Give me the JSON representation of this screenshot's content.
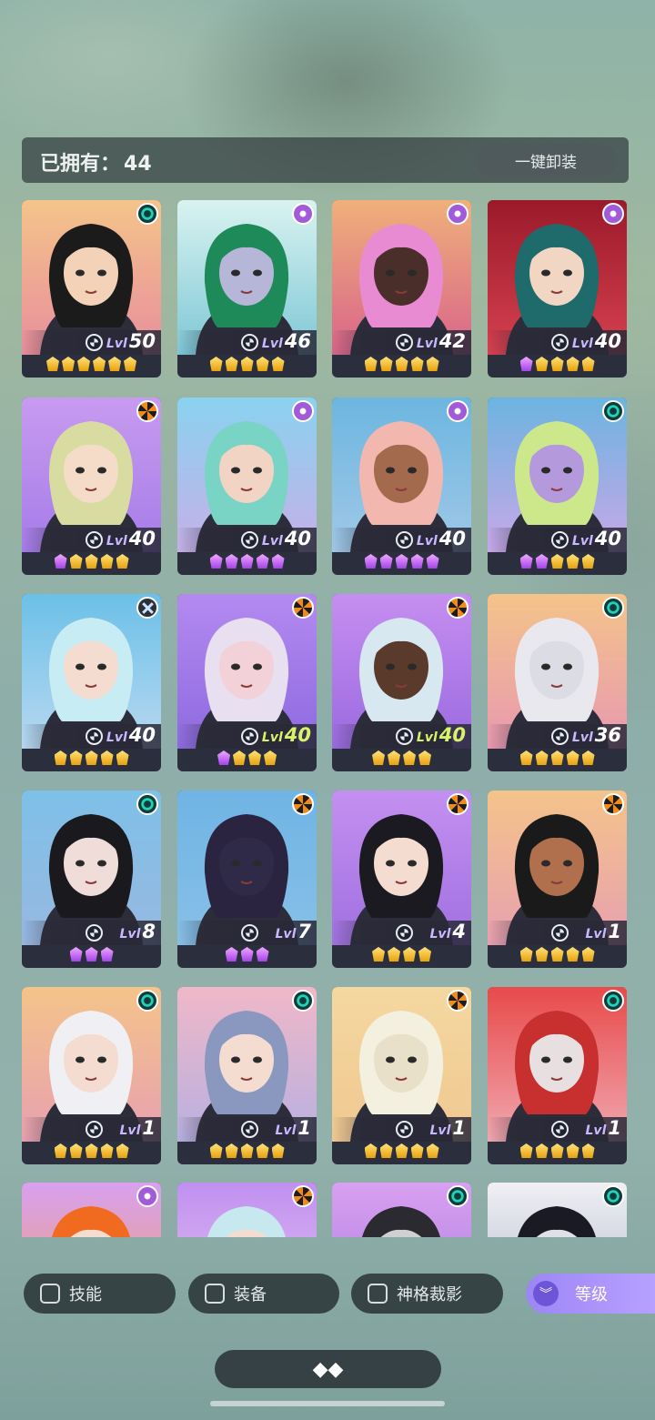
{
  "header": {
    "owned_label": "已拥有：",
    "owned_count": "44",
    "unequip_label": "一键卸装"
  },
  "level_prefix": "Lvl",
  "cards": [
    {
      "level": "50",
      "element": "teal",
      "stars": [
        "gold",
        "gold",
        "gold",
        "gold",
        "gold",
        "gold"
      ],
      "bg": [
        "#f4c48a",
        "#e88e9c"
      ],
      "hair": "#1b1b1b",
      "skin": "#f3d2b8"
    },
    {
      "level": "46",
      "element": "purple",
      "stars": [
        "gold",
        "gold",
        "gold",
        "gold",
        "gold"
      ],
      "bg": [
        "#d9f3f0",
        "#7ec7d6"
      ],
      "hair": "#1e8a5a",
      "skin": "#b6b6d8"
    },
    {
      "level": "42",
      "element": "purple",
      "stars": [
        "gold",
        "gold",
        "gold",
        "gold",
        "gold"
      ],
      "bg": [
        "#f0b07a",
        "#d8648a"
      ],
      "hair": "#e88bd2",
      "skin": "#4a2e2a"
    },
    {
      "level": "40",
      "element": "purple",
      "stars": [
        "purple",
        "gold",
        "gold",
        "gold",
        "gold"
      ],
      "bg": [
        "#9a1a2a",
        "#d64050"
      ],
      "hair": "#1f6a6a",
      "skin": "#f2d6c4"
    },
    {
      "level": "40",
      "element": "orange",
      "stars": [
        "purple",
        "gold",
        "gold",
        "gold",
        "gold"
      ],
      "bg": [
        "#c79bf0",
        "#a67ce8"
      ],
      "hair": "#d9dca0",
      "skin": "#f4dcc8"
    },
    {
      "level": "40",
      "element": "purple",
      "stars": [
        "purple",
        "purple",
        "purple",
        "purple",
        "purple"
      ],
      "bg": [
        "#8ad2f0",
        "#c6b0e8"
      ],
      "hair": "#7ad4c6",
      "skin": "#f2d4c4"
    },
    {
      "level": "40",
      "element": "purple",
      "stars": [
        "purple",
        "purple",
        "purple",
        "purple",
        "purple"
      ],
      "bg": [
        "#6cb6e0",
        "#a0c8e8"
      ],
      "hair": "#f2b8b0",
      "skin": "#a46a4e"
    },
    {
      "level": "40",
      "element": "teal",
      "stars": [
        "purple",
        "purple",
        "gold",
        "gold",
        "gold"
      ],
      "bg": [
        "#6cb4e0",
        "#c8a8e8"
      ],
      "hair": "#cde88a",
      "skin": "#b49adc"
    },
    {
      "level": "40",
      "element": "cross",
      "stars": [
        "gold",
        "gold",
        "gold",
        "gold",
        "gold"
      ],
      "bg": [
        "#6cc0e8",
        "#b8d8f0"
      ],
      "hair": "#c8ecf4",
      "skin": "#f4dcd0"
    },
    {
      "level": "40",
      "element": "orange",
      "stars": [
        "purple",
        "gold",
        "gold",
        "gold"
      ],
      "bg": [
        "#b48af0",
        "#8e6ae0"
      ],
      "hair": "#e8e0f0",
      "skin": "#f2d2d8",
      "hi": true
    },
    {
      "level": "40",
      "element": "orange",
      "stars": [
        "gold",
        "gold",
        "gold",
        "gold"
      ],
      "bg": [
        "#c68ef0",
        "#9a6ae0"
      ],
      "hair": "#d8e8f0",
      "skin": "#5a3a2a",
      "hi": true
    },
    {
      "level": "36",
      "element": "teal",
      "stars": [
        "gold",
        "gold",
        "gold",
        "gold",
        "gold"
      ],
      "bg": [
        "#f4c48a",
        "#e898b0"
      ],
      "hair": "#e8e8ee",
      "skin": "#dcdce4"
    },
    {
      "level": "8",
      "element": "teal",
      "stars": [
        "purple",
        "purple",
        "purple"
      ],
      "bg": [
        "#7ec0e8",
        "#98b8e0"
      ],
      "hair": "#1a1a1e",
      "skin": "#f0dcd8"
    },
    {
      "level": "7",
      "element": "orange",
      "stars": [
        "purple",
        "purple",
        "purple"
      ],
      "bg": [
        "#6fb4e4",
        "#88c0e8"
      ],
      "hair": "#2a2440",
      "skin": "#2e2a48"
    },
    {
      "level": "4",
      "element": "orange",
      "stars": [
        "gold",
        "gold",
        "gold",
        "gold"
      ],
      "bg": [
        "#c490f0",
        "#a070e0"
      ],
      "hair": "#1a1a20",
      "skin": "#f4dcd0"
    },
    {
      "level": "1",
      "element": "orange",
      "stars": [
        "gold",
        "gold",
        "gold",
        "gold",
        "gold"
      ],
      "bg": [
        "#f4c48a",
        "#e8a0b0"
      ],
      "hair": "#1a1a1a",
      "skin": "#b0704e"
    },
    {
      "level": "1",
      "element": "teal",
      "stars": [
        "gold",
        "gold",
        "gold",
        "gold",
        "gold"
      ],
      "bg": [
        "#f4c48a",
        "#e8a0b0"
      ],
      "hair": "#f0f0f4",
      "skin": "#f4dcd0"
    },
    {
      "level": "1",
      "element": "teal",
      "stars": [
        "gold",
        "gold",
        "gold",
        "gold",
        "gold"
      ],
      "bg": [
        "#f0b8c8",
        "#b8b0e0"
      ],
      "hair": "#8a98c0",
      "skin": "#f4dcd0"
    },
    {
      "level": "1",
      "element": "orange",
      "stars": [
        "gold",
        "gold",
        "gold",
        "gold",
        "gold"
      ],
      "bg": [
        "#f4d8a0",
        "#f0c890"
      ],
      "hair": "#f4f0e0",
      "skin": "#e8e0c8"
    },
    {
      "level": "1",
      "element": "teal",
      "stars": [
        "gold",
        "gold",
        "gold",
        "gold",
        "gold"
      ],
      "bg": [
        "#e84a4a",
        "#f0a8b0"
      ],
      "hair": "#c83030",
      "skin": "#e8e0e0"
    },
    {
      "level": "",
      "element": "purple",
      "stars": [],
      "bg": [
        "#d8a0f0",
        "#f0a060"
      ],
      "hair": "#f06a20",
      "skin": "#f4dcd0"
    },
    {
      "level": "",
      "element": "orange",
      "stars": [],
      "bg": [
        "#c090f0",
        "#e8c8f0"
      ],
      "hair": "#c8e8f0",
      "skin": "#f4dcd0"
    },
    {
      "level": "",
      "element": "teal",
      "stars": [],
      "bg": [
        "#d8a0f0",
        "#a878e0"
      ],
      "hair": "#2a2a30",
      "skin": "#d0d0d0"
    },
    {
      "level": "",
      "element": "teal",
      "stars": [],
      "bg": [
        "#f0f0f4",
        "#a8b0c8"
      ],
      "hair": "#1a1a24",
      "skin": "#e0e0e8"
    }
  ],
  "filters": {
    "skill": "技能",
    "equipment": "装备",
    "divine": "神格裁影",
    "sort_label": "等级"
  }
}
